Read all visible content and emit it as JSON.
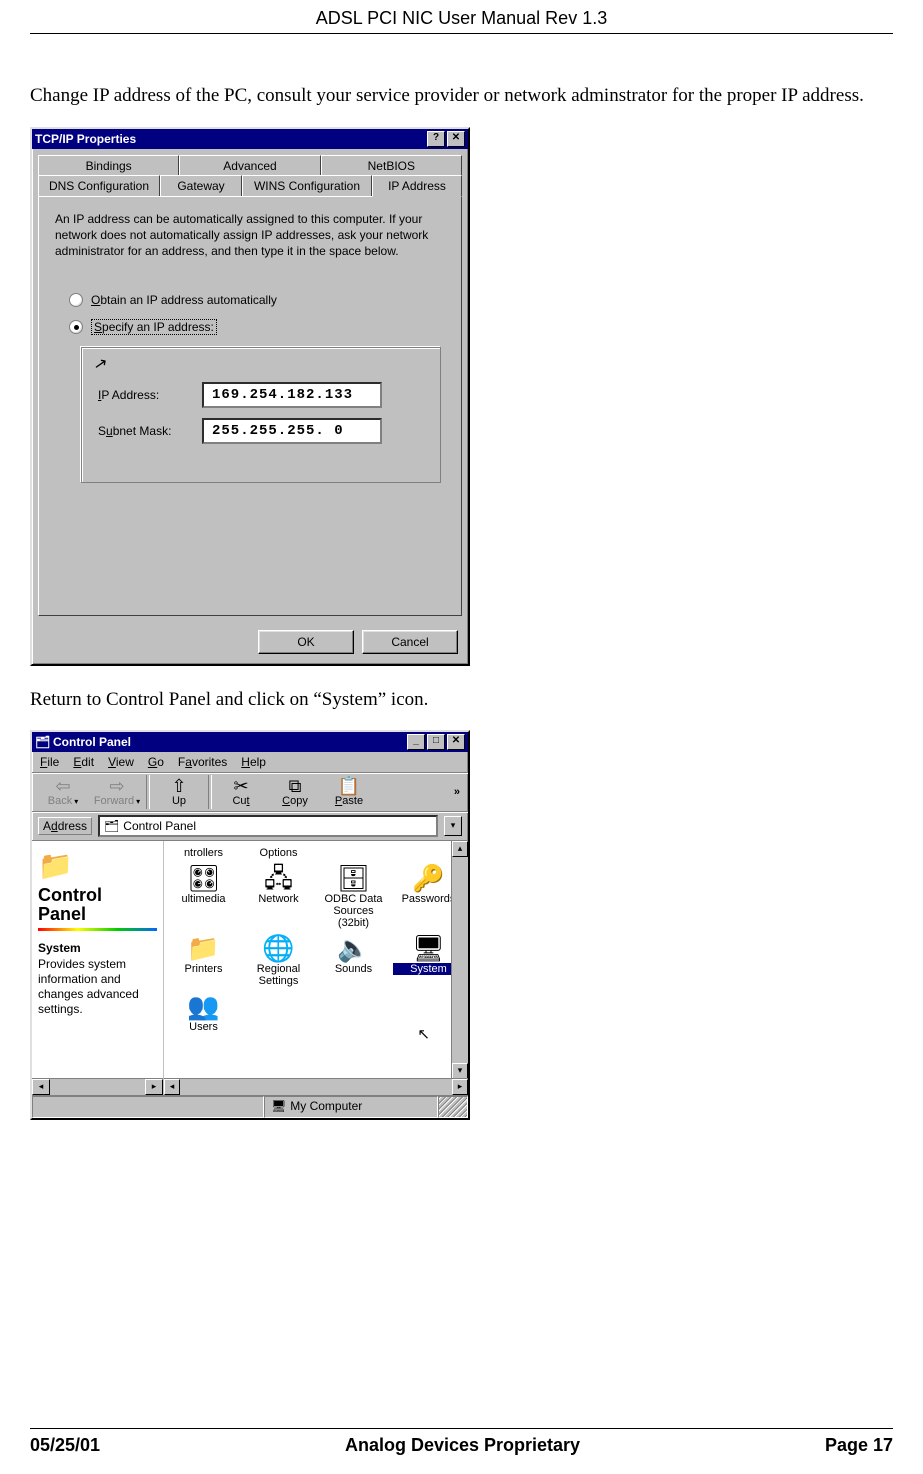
{
  "header": {
    "title": "ADSL PCI NIC User Manual Rev 1.3"
  },
  "para1": "Change IP address of the PC, consult your service provider or network adminstrator for the proper IP address.",
  "para2": "Return to Control Panel and click on “System” icon.",
  "footer": {
    "left": "05/25/01",
    "center": "Analog Devices Proprietary",
    "right": "Page 17"
  },
  "tcpip": {
    "title": "TCP/IP Properties",
    "help_btn": "?",
    "close_btn": "✕",
    "tabs_row1": [
      "Bindings",
      "Advanced",
      "NetBIOS"
    ],
    "tabs_row2": [
      "DNS Configuration",
      "Gateway",
      "WINS Configuration",
      "IP Address"
    ],
    "active_tab": "IP Address",
    "description": "An IP address can be automatically assigned to this computer. If your network does not automatically assign IP addresses, ask your network administrator for an address, and then type it in the space below.",
    "radio_auto": "Obtain an IP address automatically",
    "radio_auto_ul": "O",
    "radio_specify": "Specify an IP address:",
    "radio_specify_ul": "S",
    "ip_label": "IP Address:",
    "ip_label_ul": "I",
    "ip_value": "169.254.182.133",
    "mask_label": "Subnet Mask:",
    "mask_label_ul": "u",
    "mask_value": "255.255.255. 0",
    "ok": "OK",
    "cancel": "Cancel"
  },
  "cp": {
    "title": "Control Panel",
    "min": "_",
    "max": "□",
    "close": "✕",
    "menus": [
      {
        "ul": "F",
        "rest": "ile"
      },
      {
        "ul": "E",
        "rest": "dit"
      },
      {
        "ul": "V",
        "rest": "iew"
      },
      {
        "ul": "G",
        "rest": "o"
      },
      {
        "pre": "F",
        "ul": "a",
        "rest": "vorites"
      },
      {
        "ul": "H",
        "rest": "elp"
      }
    ],
    "tools": [
      {
        "name": "back",
        "label": "Back",
        "icon": "⇦",
        "disabled": true,
        "drop": true
      },
      {
        "name": "forward",
        "label": "Forward",
        "icon": "⇨",
        "disabled": true,
        "drop": true
      },
      {
        "name": "up",
        "label": "Up",
        "icon": "⇧",
        "disabled": false
      },
      {
        "name": "cut",
        "label": "Cut",
        "icon": "✂",
        "disabled": false,
        "ul": "t"
      },
      {
        "name": "copy",
        "label": "Copy",
        "icon": "⧉",
        "disabled": false,
        "ul": "C"
      },
      {
        "name": "paste",
        "label": "Paste",
        "icon": "📋",
        "disabled": false,
        "ul": "P"
      }
    ],
    "more": "»",
    "address_label": "Address",
    "address_value": "Control Panel",
    "left": {
      "title1": "Control",
      "title2": "Panel",
      "selected": "System",
      "desc": "Provides system information and changes advanced settings."
    },
    "headerrow": [
      "ntrollers",
      "Options",
      "",
      ""
    ],
    "items_row1": [
      {
        "name": "multimedia",
        "label": "ultimedia",
        "icon": "🎛"
      },
      {
        "name": "network",
        "label": "Network",
        "icon": "🖧"
      },
      {
        "name": "odbc",
        "label": "ODBC Data Sources (32bit)",
        "icon": "🗄"
      },
      {
        "name": "passwords",
        "label": "Passwords",
        "icon": "🔑"
      }
    ],
    "items_row2": [
      {
        "name": "printers",
        "label": "Printers",
        "icon": "📁"
      },
      {
        "name": "regional",
        "label": "Regional Settings",
        "icon": "🌐"
      },
      {
        "name": "sounds",
        "label": "Sounds",
        "icon": "🔈"
      },
      {
        "name": "system",
        "label": "System",
        "icon": "🖥",
        "selected": true
      }
    ],
    "items_row3": [
      {
        "name": "users",
        "label": "Users",
        "icon": "👥"
      }
    ],
    "status_right": "My Computer",
    "status_icon": "🖥"
  }
}
